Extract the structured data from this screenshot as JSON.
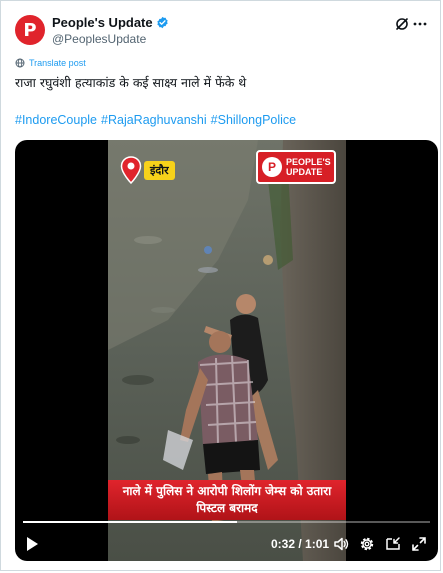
{
  "author": {
    "display_name": "People's Update",
    "handle": "@PeoplesUpdate",
    "avatar_letter": "P",
    "avatar_color": "#e0242c",
    "verified": true
  },
  "post": {
    "translate_label": "Translate post",
    "text": "राजा रघुवंशी हत्याकांड के कई साक्ष्य नाले में फेंके थे",
    "hashtags": [
      "#IndoreCouple",
      "#RajaRaghuvanshi",
      "#ShillongPolice"
    ],
    "link_color": "#1d9bf0"
  },
  "video": {
    "location_label": "इंदौर",
    "brand_logo_text": [
      "PEOPLE'S",
      "UPDATE"
    ],
    "caption_lines": [
      "नाले में पुलिस ने आरोपी शिलोंग जेम्स को उतारा",
      "पिस्टल बरामद"
    ],
    "time_display": "0:32 / 1:01",
    "progress": 0.525
  },
  "icons": {
    "verified": "verified-badge-icon",
    "grok": "grok-icon",
    "more": "more-options-icon",
    "translate": "globe-icon",
    "play": "play-icon",
    "volume": "volume-icon",
    "settings": "settings-gear-icon",
    "pip": "picture-in-picture-icon",
    "fullscreen": "fullscreen-icon"
  }
}
